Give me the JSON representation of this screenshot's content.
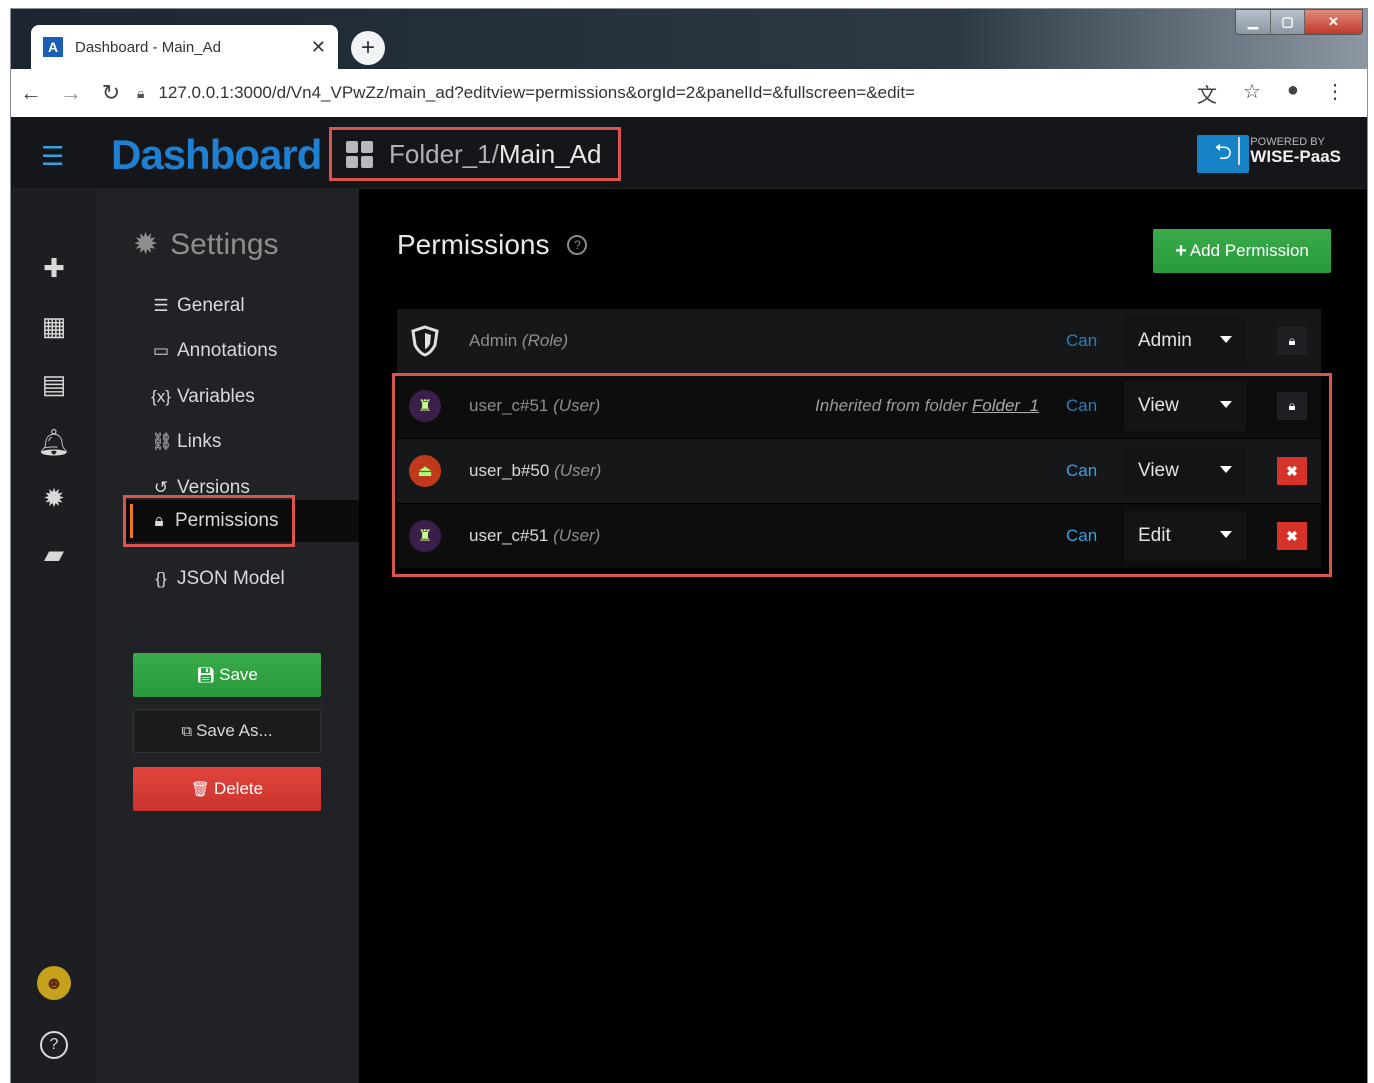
{
  "browser": {
    "tab_title": "Dashboard - Main_Ad",
    "url": "127.0.0.1:3000/d/Vn4_VPwZz/main_ad?editview=permissions&orgId=2&panelId=&fullscreen=&edit=",
    "new_tab_glyph": "+",
    "close_glyph": "✕"
  },
  "header": {
    "brand": "Dashboard",
    "breadcrumb_folder": "Folder_1/",
    "breadcrumb_dashboard": "Main_Ad",
    "powered_small": "POWERED BY",
    "powered_big": "WISE-PaaS"
  },
  "sidebar_icons": [
    "plus-icon",
    "dashboards-icon",
    "explore-icon",
    "alert-bell-icon",
    "gear-icon",
    "book-icon",
    "user-avatar",
    "help-icon"
  ],
  "settings": {
    "title": "Settings",
    "items": [
      {
        "label": "General",
        "icon": "sliders-icon"
      },
      {
        "label": "Annotations",
        "icon": "comment-icon"
      },
      {
        "label": "Variables",
        "icon": "variables-icon"
      },
      {
        "label": "Links",
        "icon": "link-icon"
      },
      {
        "label": "Versions",
        "icon": "history-icon"
      },
      {
        "label": "Permissions",
        "icon": "lock-icon"
      },
      {
        "label": "JSON Model",
        "icon": "json-icon"
      }
    ],
    "active_item": "Permissions",
    "save_label": "Save",
    "save_as_label": "Save As...",
    "delete_label": "Delete"
  },
  "permissions": {
    "title": "Permissions",
    "add_label": "Add Permission",
    "rows": [
      {
        "name": "Admin",
        "kind": "(Role)",
        "inherited": "",
        "can": "Can",
        "level": "Admin",
        "action": "lock"
      },
      {
        "name": "user_c#51",
        "kind": "(User)",
        "inherited_prefix": "Inherited from folder",
        "inherited_folder": "Folder_1",
        "can": "Can",
        "level": "View",
        "action": "lock"
      },
      {
        "name": "user_b#50",
        "kind": "(User)",
        "inherited": "",
        "can": "Can",
        "level": "View",
        "action": "delete"
      },
      {
        "name": "user_c#51",
        "kind": "(User)",
        "inherited": "",
        "can": "Can",
        "level": "Edit",
        "action": "delete"
      }
    ]
  },
  "colors": {
    "accent_blue": "#33a2e5",
    "brand_blue": "#1f7fd0",
    "green": "#3aab4b",
    "red": "#d6332a",
    "highlight": "#d9534f"
  }
}
